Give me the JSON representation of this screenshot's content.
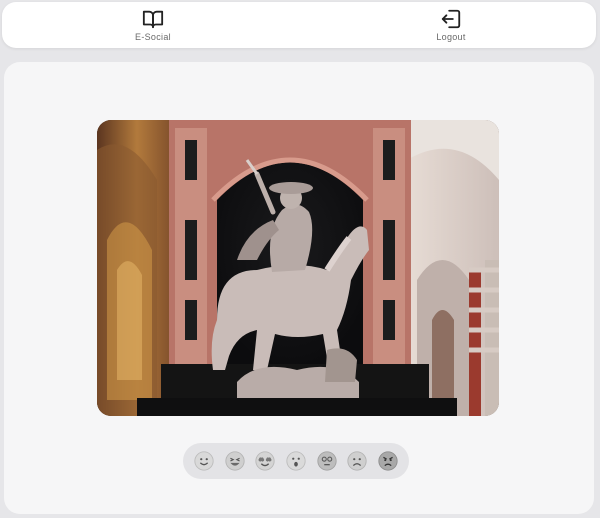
{
  "topbar": {
    "items": [
      {
        "label": "E-Social",
        "icon": "open-book-icon"
      },
      {
        "label": "Logout",
        "icon": "logout-icon"
      }
    ]
  },
  "post": {
    "image_subject": "equestrian-statue-in-cathedral"
  },
  "reactions": [
    {
      "icon": "smile-emoji-icon"
    },
    {
      "icon": "laughing-emoji-icon"
    },
    {
      "icon": "heart-eyes-emoji-icon"
    },
    {
      "icon": "surprised-emoji-icon"
    },
    {
      "icon": "dizzy-emoji-icon"
    },
    {
      "icon": "sad-emoji-icon"
    },
    {
      "icon": "angry-emoji-icon"
    }
  ],
  "colors": {
    "background": "#e6e6e9",
    "card": "#f6f6f7",
    "reaction_bar": "#e3e3e6",
    "icon": "#222222"
  }
}
